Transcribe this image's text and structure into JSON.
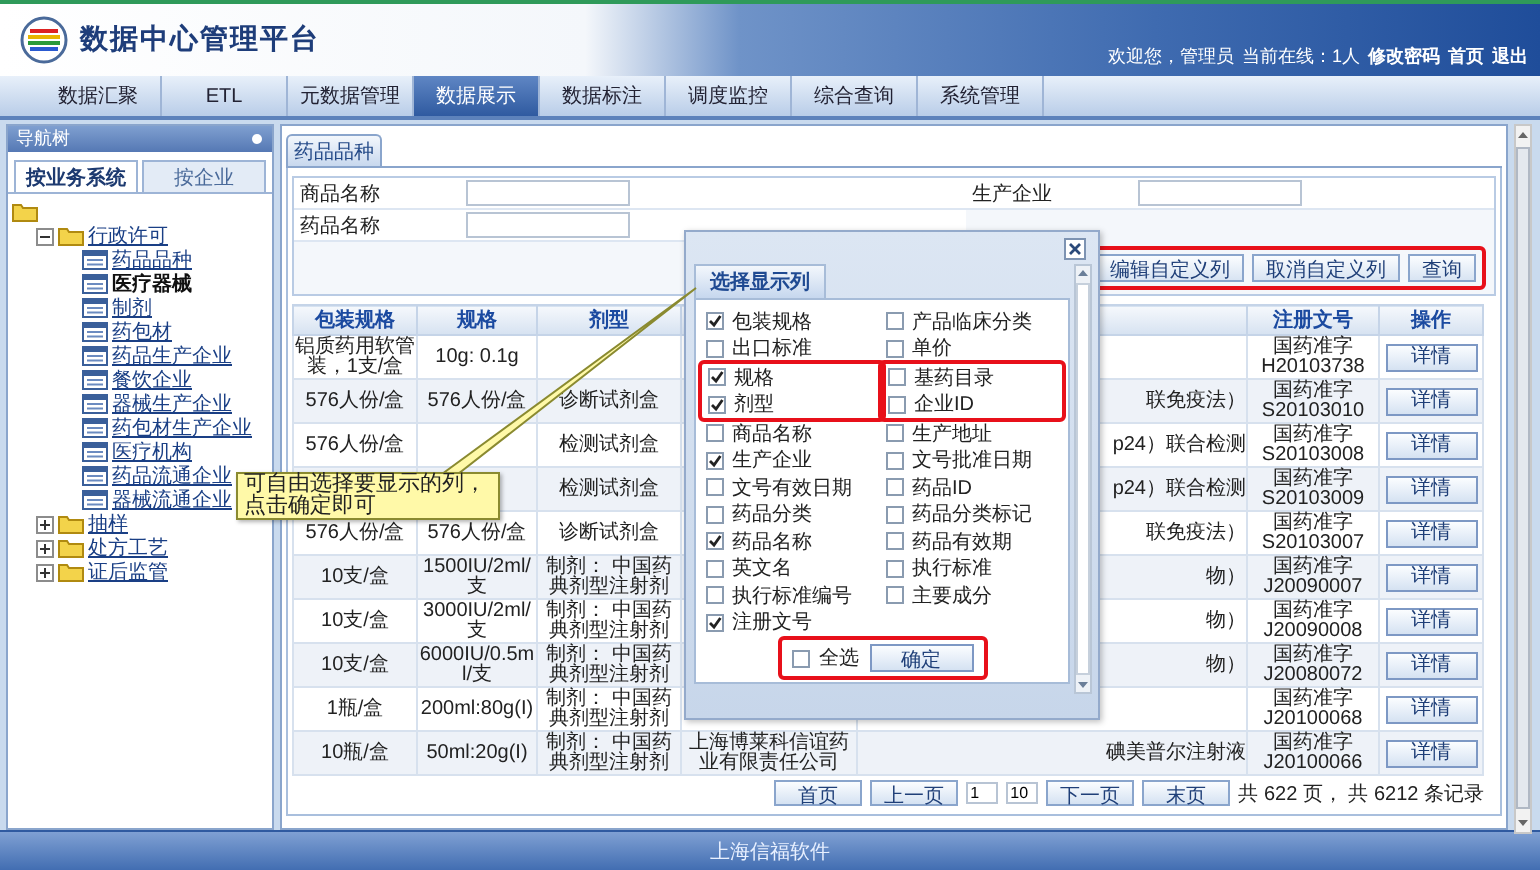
{
  "header": {
    "title": "数据中心管理平台",
    "welcome": "欢迎您，管理员",
    "online": "当前在线：1人",
    "links": [
      "修改密码",
      "首页",
      "退出"
    ]
  },
  "nav_tabs": [
    {
      "label": "数据汇聚",
      "selected": false
    },
    {
      "label": "ETL",
      "selected": false
    },
    {
      "label": "元数据管理",
      "selected": false
    },
    {
      "label": "数据展示",
      "selected": true
    },
    {
      "label": "数据标注",
      "selected": false
    },
    {
      "label": "调度监控",
      "selected": false
    },
    {
      "label": "综合查询",
      "selected": false
    },
    {
      "label": "系统管理",
      "selected": false
    }
  ],
  "sidebar": {
    "title": "导航树",
    "tabs": [
      {
        "label": "按业务系统",
        "selected": true
      },
      {
        "label": "按企业",
        "selected": false
      }
    ],
    "tree": {
      "children": [
        {
          "label": "行政许可",
          "expanded": true,
          "children": [
            {
              "label": "药品品种",
              "selected": false
            },
            {
              "label": "医疗器械",
              "selected": true
            },
            {
              "label": "制剂",
              "selected": false
            },
            {
              "label": "药包材",
              "selected": false
            },
            {
              "label": "药品生产企业",
              "selected": false
            },
            {
              "label": "餐饮企业",
              "selected": false
            },
            {
              "label": "器械生产企业",
              "selected": false
            },
            {
              "label": "药包材生产企业",
              "selected": false
            },
            {
              "label": "医疗机构",
              "selected": false
            },
            {
              "label": "药品流通企业",
              "selected": false
            },
            {
              "label": "器械流通企业",
              "selected": false
            }
          ]
        },
        {
          "label": "抽样",
          "expanded": false
        },
        {
          "label": "处方工艺",
          "expanded": false
        },
        {
          "label": "证后监管",
          "expanded": false
        }
      ]
    }
  },
  "content": {
    "tab": "药品品种",
    "form": {
      "fields": [
        {
          "label": "商品名称"
        },
        {
          "label": "生产企业"
        },
        {
          "label": "药品名称"
        }
      ],
      "buttons": [
        "编辑自定义列",
        "取消自定义列",
        "查询"
      ],
      "buttons_highlighted": true
    },
    "table": {
      "columns": {
        "packaging": "包装规格",
        "spec": "规格",
        "dosage_form": "剂型",
        "approval_no": "注册文号",
        "action": "操作"
      },
      "rows": [
        {
          "packaging": "铝质药用软管装，1支/盒",
          "spec": "10g: 0.1g",
          "approval_no": "国药准字 H20103738",
          "action": "详情"
        },
        {
          "packaging": "576人份/盒",
          "spec": "576人份/盒",
          "dosage_form": "诊断试剂盒",
          "column_5": "联免疫法）",
          "approval_no": "国药准字 S20103010",
          "action": "详情"
        },
        {
          "packaging": "576人份/盒",
          "dosage_form": "检测试剂盒",
          "column_5": "p24）联合检测",
          "approval_no": "国药准字 S20103008",
          "action": "详情"
        },
        {
          "dosage_form": "检测试剂盒",
          "column_5": "p24）联合检测",
          "approval_no": "国药准字 S20103009",
          "action": "详情"
        },
        {
          "packaging": "576人份/盒",
          "spec": "576人份/盒",
          "dosage_form": "诊断试剂盒",
          "column_5": "联免疫法）",
          "approval_no": "国药准字 S20103007",
          "action": "详情"
        },
        {
          "packaging": "10支/盒",
          "spec": "1500IU/2ml/支",
          "dosage_form": "制剂： 中国药典剂型注射剂",
          "column_5": "物）",
          "approval_no": "国药准字 J20090007",
          "action": "详情"
        },
        {
          "packaging": "10支/盒",
          "spec": "3000IU/2ml/支",
          "dosage_form": "制剂： 中国药典剂型注射剂",
          "column_5": "物）",
          "approval_no": "国药准字 J20090008",
          "action": "详情"
        },
        {
          "packaging": "10支/盒",
          "spec": "6000IU/0.5ml/支",
          "dosage_form": "制剂： 中国药典剂型注射剂",
          "column_5": "物）",
          "approval_no": "国药准字 J20080072",
          "action": "详情"
        },
        {
          "packaging": "1瓶/盒",
          "spec": "200ml:80g(I)",
          "dosage_form": "制剂： 中国药典剂型注射剂",
          "approval_no": "国药准字 J20100068",
          "action": "详情"
        },
        {
          "packaging": "10瓶/盒",
          "spec": "50ml:20g(I)",
          "dosage_form": "制剂： 中国药典剂型注射剂",
          "column_4": "上海博莱科信谊药业有限责任公司",
          "column_5": "碘美普尔注射液",
          "approval_no": "国药准字 J20100066",
          "action": "详情"
        }
      ]
    },
    "pagination": {
      "first": "首页",
      "prev": "上一页",
      "page": "1",
      "page_size": "10",
      "next": "下一页",
      "last": "末页",
      "summary": "共 622 页， 共 6212 条记录"
    }
  },
  "dialog": {
    "tab": "选择显示列",
    "options_left": [
      {
        "label": "包装规格",
        "checked": true,
        "highlighted": false
      },
      {
        "label": "出口标准",
        "checked": false,
        "highlighted": false
      },
      {
        "label": "规格",
        "checked": true,
        "highlighted": true
      },
      {
        "label": "剂型",
        "checked": true,
        "highlighted": true
      },
      {
        "label": "商品名称",
        "checked": false,
        "highlighted": false
      },
      {
        "label": "生产企业",
        "checked": true,
        "highlighted": false
      },
      {
        "label": "文号有效日期",
        "checked": false,
        "highlighted": false
      },
      {
        "label": "药品分类",
        "checked": false,
        "highlighted": false
      },
      {
        "label": "药品名称",
        "checked": true,
        "highlighted": false
      },
      {
        "label": "英文名",
        "checked": false,
        "highlighted": false
      },
      {
        "label": "执行标准编号",
        "checked": false,
        "highlighted": false
      },
      {
        "label": "注册文号",
        "checked": true,
        "highlighted": false
      }
    ],
    "options_right": [
      {
        "label": "产品临床分类",
        "checked": false,
        "highlighted": false
      },
      {
        "label": "单价",
        "checked": false,
        "highlighted": false
      },
      {
        "label": "基药目录",
        "checked": false,
        "highlighted": true
      },
      {
        "label": "企业ID",
        "checked": false,
        "highlighted": true
      },
      {
        "label": "生产地址",
        "checked": false,
        "highlighted": false
      },
      {
        "label": "文号批准日期",
        "checked": false,
        "highlighted": false
      },
      {
        "label": "药品ID",
        "checked": false,
        "highlighted": false
      },
      {
        "label": "药品分类标记",
        "checked": false,
        "highlighted": false
      },
      {
        "label": "药品有效期",
        "checked": false,
        "highlighted": false
      },
      {
        "label": "执行标准",
        "checked": false,
        "highlighted": false
      },
      {
        "label": "主要成分",
        "checked": false,
        "highlighted": false
      }
    ],
    "select_all": {
      "label": "全选",
      "checked": false
    },
    "confirm": "确定",
    "footer_highlighted": true
  },
  "callout": "可自由选择要显示的列，点击确定即可",
  "footer": "上海信福软件"
}
